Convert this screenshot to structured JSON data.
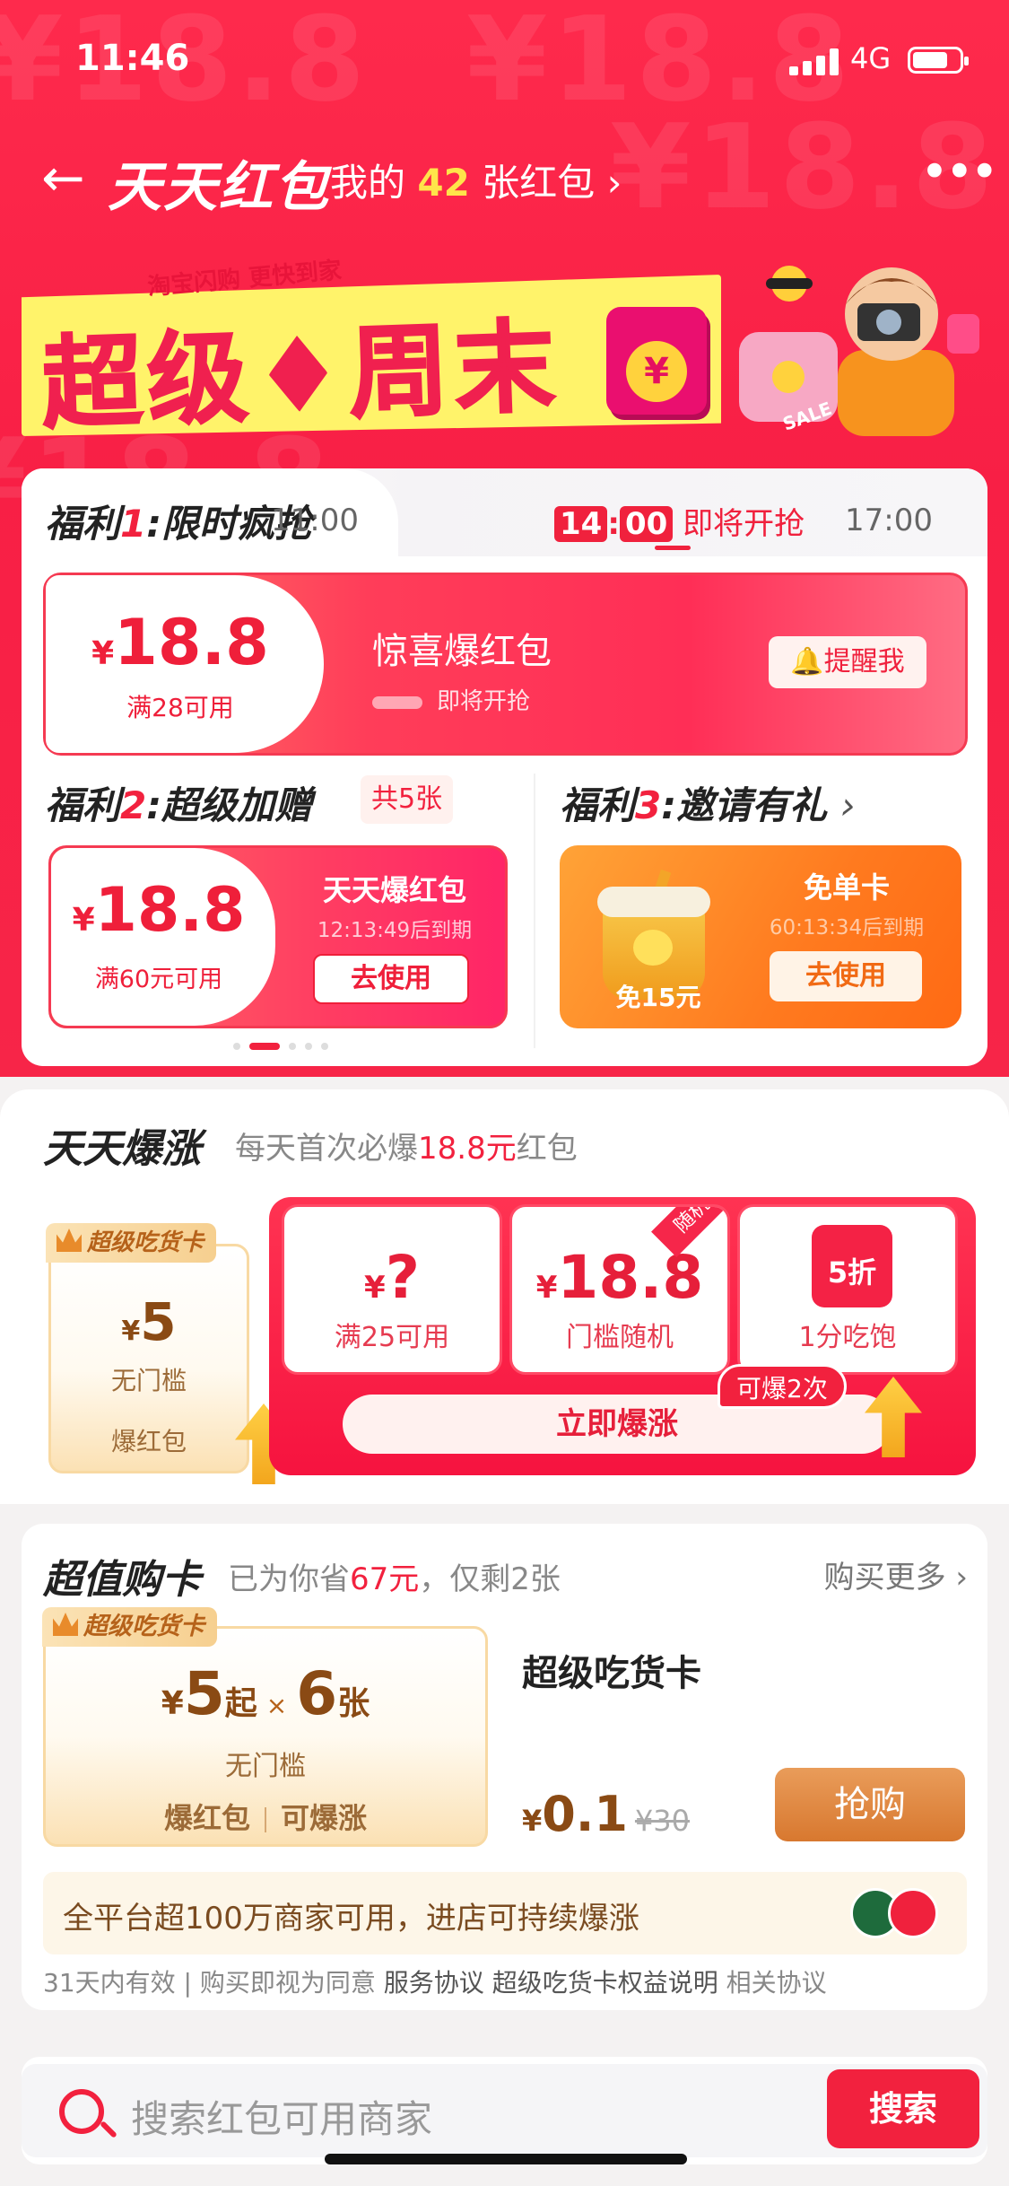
{
  "status": {
    "time": "11:46",
    "network": "4G"
  },
  "nav": {
    "title": "天天红包",
    "my_prefix": "我的",
    "my_count": "42",
    "my_suffix": "张红包",
    "watermark": "¥18.8"
  },
  "banner": {
    "subtitle": "淘宝闪购 更快到家",
    "title": "超级♦周末",
    "envelope_symbol": "¥",
    "sale_text": "SALE"
  },
  "benefit1": {
    "label_prefix": "福利",
    "num": "1",
    "label_suffix": ":限时疯抢",
    "slots": [
      "11:00",
      "17:00"
    ],
    "current_hour": "14",
    "current_min": "00",
    "current_status": "即将开抢",
    "coupon": {
      "currency": "¥",
      "amount": "18.8",
      "condition": "满28可用",
      "name": "惊喜爆红包",
      "status": "即将开抢",
      "remind": "提醒我"
    }
  },
  "benefit2": {
    "label_prefix": "福利",
    "num": "2",
    "label_suffix": ":超级加赠",
    "tag": "共5张",
    "coupon": {
      "currency": "¥",
      "amount": "18.8",
      "condition": "满60元可用",
      "name": "天天爆红包",
      "expiry": "12:13:49后到期",
      "action": "去使用"
    }
  },
  "benefit3": {
    "label_prefix": "福利",
    "num": "3",
    "label_suffix": ":邀请有礼",
    "coupon": {
      "badge": "免15元",
      "name": "免单卡",
      "expiry": "60:13:34后到期",
      "action": "去使用"
    }
  },
  "daily": {
    "title": "天天爆涨",
    "subtitle_prefix": "每天首次必爆",
    "subtitle_amount": "18.8元",
    "subtitle_suffix": "红包",
    "food_card": {
      "badge": "超级吃货卡",
      "currency": "¥",
      "amount": "5",
      "condition": "无门槛",
      "name": "爆红包"
    },
    "cells": [
      {
        "currency": "¥",
        "amount": "?",
        "condition": "满25可用"
      },
      {
        "currency": "¥",
        "amount": "18.8",
        "condition": "门槛随机",
        "tag": "随机"
      },
      {
        "icon_text": "5折",
        "condition": "1分吃饱"
      }
    ],
    "button": "立即爆涨",
    "bubble": "可爆2次"
  },
  "supercard": {
    "title": "超值购卡",
    "subtitle_prefix": "已为你省",
    "saved": "67元",
    "subtitle_suffix": "，仅剩2张",
    "buy_more": "购买更多 ›",
    "card": {
      "badge": "超级吃货卡",
      "currency": "¥",
      "amount": "5",
      "from": "起",
      "times": "×",
      "count": "6",
      "unit": "张",
      "condition": "无门槛",
      "feature1": "爆红包",
      "feature2": "可爆涨"
    },
    "product_name": "超级吃货卡",
    "price_currency": "¥",
    "price": "0.1",
    "old_price": "¥30",
    "grab": "抢购",
    "notice": "全平台超100万商家可用，进店可持续爆涨",
    "terms": {
      "valid": "31天内有效",
      "agree": "购买即视为同意",
      "link1": "服务协议",
      "link2": "超级吃货卡权益说明",
      "link3": "相关协议"
    }
  },
  "search": {
    "placeholder": "搜索红包可用商家",
    "button": "搜索"
  },
  "colors": {
    "primary_red": "#f2213e",
    "gold": "#8a4a14",
    "yellow": "#fff36a"
  }
}
